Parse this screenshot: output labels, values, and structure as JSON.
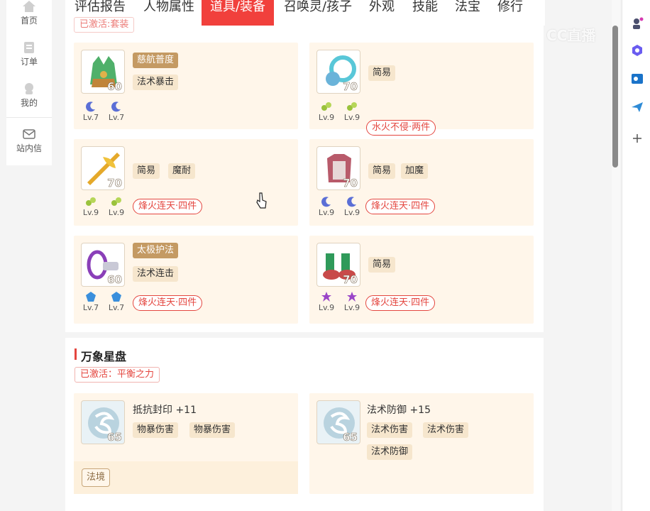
{
  "nav": {
    "items": [
      {
        "label": "首页",
        "icon": "home-icon"
      },
      {
        "label": "订单",
        "icon": "order-icon"
      },
      {
        "label": "我的",
        "icon": "user-icon"
      },
      {
        "label": "站内信",
        "icon": "mail-icon"
      }
    ]
  },
  "tabs": [
    {
      "label": "评估报告"
    },
    {
      "label": "人物属性"
    },
    {
      "label": "道具/装备",
      "active": true
    },
    {
      "label": "召唤灵/孩子"
    },
    {
      "label": "外观"
    },
    {
      "label": "技能"
    },
    {
      "label": "法宝"
    },
    {
      "label": "修行"
    }
  ],
  "watermark": "CC直播",
  "equipment": {
    "partial_status": "已激活:套装",
    "items": [
      {
        "level": "60",
        "tags": [
          {
            "text": "慈航普度",
            "style": "gold"
          },
          {
            "text": "法术暴击"
          }
        ],
        "gems": [
          {
            "lv": "Lv.7",
            "type": "moon"
          },
          {
            "lv": "Lv.7",
            "type": "moon"
          }
        ],
        "set": "",
        "icon": "helmet-icon"
      },
      {
        "level": "70",
        "tags": [
          {
            "text": "简易"
          }
        ],
        "gems": [
          {
            "lv": "Lv.9",
            "type": "green"
          },
          {
            "lv": "Lv.9",
            "type": "green"
          }
        ],
        "set": "水火不侵·两件",
        "icon": "necklace-icon"
      },
      {
        "level": "70",
        "tags": [
          {
            "text": "简易"
          },
          {
            "text": "魔耐"
          }
        ],
        "gems": [
          {
            "lv": "Lv.9",
            "type": "green"
          },
          {
            "lv": "Lv.9",
            "type": "green"
          }
        ],
        "set": "烽火连天·四件",
        "icon": "weapon-icon"
      },
      {
        "level": "70",
        "tags": [
          {
            "text": "简易"
          },
          {
            "text": "加魔"
          }
        ],
        "gems": [
          {
            "lv": "Lv.9",
            "type": "moon"
          },
          {
            "lv": "Lv.9",
            "type": "moon"
          }
        ],
        "set": "烽火连天·四件",
        "icon": "armor-icon"
      },
      {
        "level": "60",
        "tags": [
          {
            "text": "太极护法",
            "style": "gold"
          },
          {
            "text": "法术连击"
          }
        ],
        "gems": [
          {
            "lv": "Lv.7",
            "type": "blue"
          },
          {
            "lv": "Lv.7",
            "type": "blue"
          }
        ],
        "set": "烽火连天·四件",
        "icon": "belt-icon"
      },
      {
        "level": "70",
        "tags": [
          {
            "text": "简易"
          }
        ],
        "gems": [
          {
            "lv": "Lv.9",
            "type": "purple"
          },
          {
            "lv": "Lv.9",
            "type": "purple"
          }
        ],
        "set": "烽火连天·四件",
        "icon": "boots-icon"
      }
    ]
  },
  "star_disk": {
    "title": "万象星盘",
    "status": "已激活：平衡之力",
    "items": [
      {
        "level": "65",
        "stat": "抵抗封印 +11",
        "tags": [
          "物暴伤害",
          "物暴伤害"
        ],
        "realm": "法境",
        "icon": "star-stone-icon"
      },
      {
        "level": "65",
        "stat": "法术防御 +15",
        "tags": [
          "法术伤害",
          "法术伤害",
          "法术防御"
        ],
        "realm": "",
        "icon": "star-stone-icon"
      }
    ]
  },
  "colors": {
    "accent": "#f1403c",
    "card_bg": "#fff6ea",
    "gold_tag": "#c49a63"
  }
}
